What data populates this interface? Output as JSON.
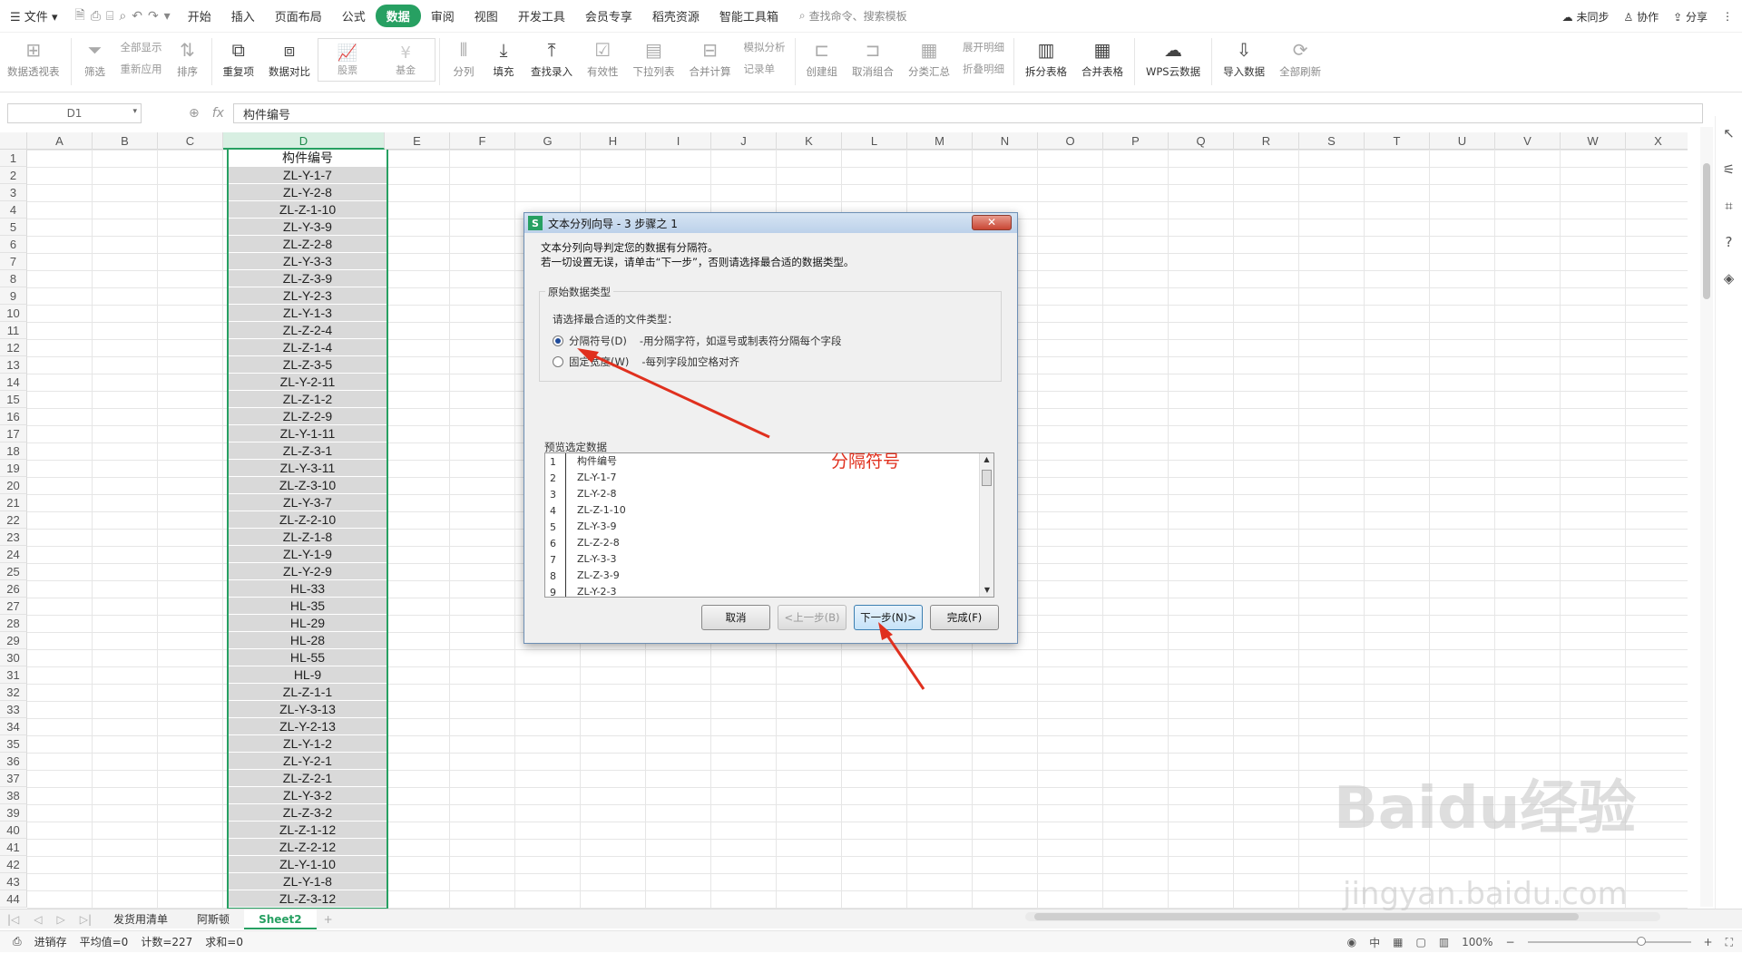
{
  "menu": {
    "file": "文件",
    "tabs": [
      "开始",
      "插入",
      "页面布局",
      "公式",
      "数据",
      "审阅",
      "视图",
      "开发工具",
      "会员专享",
      "稻壳资源",
      "智能工具箱"
    ],
    "active_tab": "数据",
    "search_placeholder": "查找命令、搜索模板",
    "sync": "未同步",
    "collab": "协作",
    "share": "分享"
  },
  "ribbon": {
    "pivot": "数据透视表",
    "filter": "筛选",
    "show_all": "全部显示",
    "reapply": "重新应用",
    "sort": "排序",
    "duplicates": "重复项",
    "compare": "数据对比",
    "stocks": "股票",
    "fund": "基金",
    "split": "分列",
    "fill": "填充",
    "lookup": "查找录入",
    "validity": "有效性",
    "dropdown": "下拉列表",
    "consolidate": "合并计算",
    "simulate": "模拟分析",
    "record": "记录单",
    "group": "创建组",
    "ungroup": "取消组合",
    "subtotal": "分类汇总",
    "expand": "展开明细",
    "collapse": "折叠明细",
    "split_table": "拆分表格",
    "merge_table": "合并表格",
    "wps_cloud": "WPS云数据",
    "import": "导入数据",
    "refresh": "全部刷新"
  },
  "formula": {
    "namebox": "D1",
    "fx": "fx",
    "content": "构件编号"
  },
  "columns": [
    "A",
    "B",
    "C",
    "D",
    "E",
    "F",
    "G",
    "H",
    "I",
    "J",
    "K",
    "L",
    "M",
    "N",
    "O",
    "P",
    "Q",
    "R",
    "S",
    "T",
    "U",
    "V",
    "W",
    "X"
  ],
  "rows": [
    "1",
    "2",
    "3",
    "4",
    "5",
    "6",
    "7",
    "8",
    "9",
    "10",
    "11",
    "12",
    "13",
    "14",
    "15",
    "16",
    "17",
    "18",
    "19",
    "20",
    "21",
    "22",
    "23",
    "24",
    "25",
    "26",
    "27",
    "28",
    "29",
    "30",
    "31",
    "32",
    "33",
    "34",
    "35",
    "36",
    "37",
    "38",
    "39",
    "40",
    "41",
    "42",
    "43",
    "44"
  ],
  "column_d": [
    "构件编号",
    "ZL-Y-1-7",
    "ZL-Y-2-8",
    "ZL-Z-1-10",
    "ZL-Y-3-9",
    "ZL-Z-2-8",
    "ZL-Y-3-3",
    "ZL-Z-3-9",
    "ZL-Y-2-3",
    "ZL-Y-1-3",
    "ZL-Z-2-4",
    "ZL-Z-1-4",
    "ZL-Z-3-5",
    "ZL-Y-2-11",
    "ZL-Z-1-2",
    "ZL-Z-2-9",
    "ZL-Y-1-11",
    "ZL-Z-3-1",
    "ZL-Y-3-11",
    "ZL-Z-3-10",
    "ZL-Y-3-7",
    "ZL-Z-2-10",
    "ZL-Z-1-8",
    "ZL-Y-1-9",
    "ZL-Y-2-9",
    "HL-33",
    "HL-35",
    "HL-29",
    "HL-28",
    "HL-55",
    "HL-9",
    "ZL-Z-1-1",
    "ZL-Y-3-13",
    "ZL-Y-2-13",
    "ZL-Y-1-2",
    "ZL-Y-2-1",
    "ZL-Z-2-1",
    "ZL-Y-3-2",
    "ZL-Z-3-2",
    "ZL-Z-1-12",
    "ZL-Z-2-12",
    "ZL-Y-1-10",
    "ZL-Y-1-8",
    "ZL-Z-3-12"
  ],
  "dialog": {
    "title": "文本分列向导 - 3 步骤之 1",
    "close": "✕",
    "intro1": "文本分列向导判定您的数据有分隔符。",
    "intro2": "若一切设置无误，请单击“下一步”，否则请选择最合适的数据类型。",
    "group_label": "原始数据类型",
    "choose_label": "请选择最合适的文件类型：",
    "opt1_label": "分隔符号(D)",
    "opt1_desc": "-用分隔字符，如逗号或制表符分隔每个字段",
    "opt2_label": "固定宽度(W)",
    "opt2_desc": "-每列字段加空格对齐",
    "preview_label": "预览选定数据",
    "preview_rows": [
      {
        "n": "1",
        "v": "构件编号"
      },
      {
        "n": "2",
        "v": "ZL-Y-1-7"
      },
      {
        "n": "3",
        "v": "ZL-Y-2-8"
      },
      {
        "n": "4",
        "v": "ZL-Z-1-10"
      },
      {
        "n": "5",
        "v": "ZL-Y-3-9"
      },
      {
        "n": "6",
        "v": "ZL-Z-2-8"
      },
      {
        "n": "7",
        "v": "ZL-Y-3-3"
      },
      {
        "n": "8",
        "v": "ZL-Z-3-9"
      },
      {
        "n": "9",
        "v": "ZL-Y-2-3"
      }
    ],
    "btn_cancel": "取消",
    "btn_prev": "<上一步(B)",
    "btn_next": "下一步(N)>",
    "btn_finish": "完成(F)"
  },
  "annotation": "分隔符号",
  "sheets": [
    "发货用清单",
    "阿斯顿",
    "Sheet2"
  ],
  "active_sheet": "Sheet2",
  "status": {
    "mode": "进销存",
    "avg": "平均值=0",
    "count": "计数=227",
    "sum": "求和=0",
    "zoom": "100%"
  },
  "watermark": {
    "brand": "Baidu经验",
    "url": "jingyan.baidu.com"
  },
  "colors": {
    "accent": "#27a062",
    "annotation": "#e0301e"
  }
}
